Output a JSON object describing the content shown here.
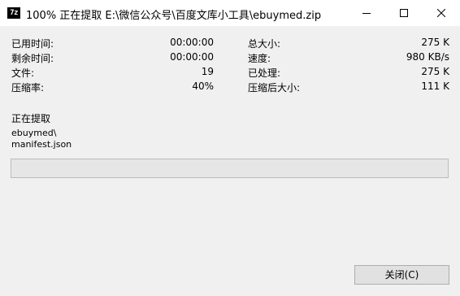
{
  "window": {
    "app_icon_text": "7z",
    "title": "100% 正在提取 E:\\微信公众号\\百度文库小工具\\ebuymed.zip"
  },
  "stats": {
    "elapsed_label": "已用时间:",
    "elapsed_value": "00:00:00",
    "remaining_label": "剩余时间:",
    "remaining_value": "00:00:00",
    "files_label": "文件:",
    "files_value": "19",
    "ratio_label": "压缩率:",
    "ratio_value": "40%",
    "total_size_label": "总大小:",
    "total_size_value": "275 K",
    "speed_label": "速度:",
    "speed_value": "980 KB/s",
    "processed_label": "已处理:",
    "processed_value": "275 K",
    "compressed_size_label": "压缩后大小:",
    "compressed_size_value": "111 K"
  },
  "current": {
    "heading": "正在提取",
    "path_line1": "ebuymed\\",
    "path_line2": "manifest.json"
  },
  "progress": {
    "percent": 0
  },
  "buttons": {
    "close_label": "关闭(C)"
  },
  "colors": {
    "progress_fill": "#06b025",
    "titlebar_bg": "#ffffff",
    "window_bg": "#f0f0f0"
  }
}
